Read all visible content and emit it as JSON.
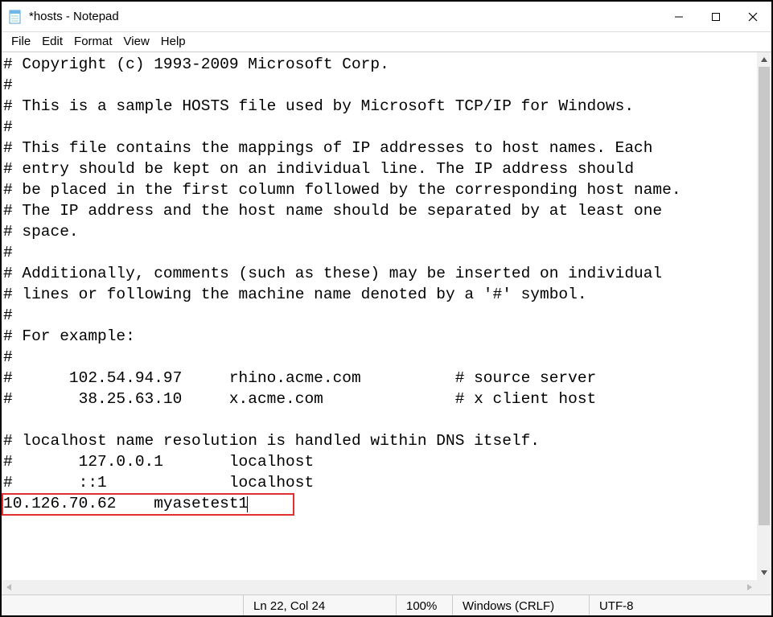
{
  "window": {
    "title": "*hosts - Notepad"
  },
  "menubar": {
    "items": [
      "File",
      "Edit",
      "Format",
      "View",
      "Help"
    ]
  },
  "editor": {
    "lines": [
      "# Copyright (c) 1993-2009 Microsoft Corp.",
      "#",
      "# This is a sample HOSTS file used by Microsoft TCP/IP for Windows.",
      "#",
      "# This file contains the mappings of IP addresses to host names. Each",
      "# entry should be kept on an individual line. The IP address should",
      "# be placed in the first column followed by the corresponding host name.",
      "# The IP address and the host name should be separated by at least one",
      "# space.",
      "#",
      "# Additionally, comments (such as these) may be inserted on individual",
      "# lines or following the machine name denoted by a '#' symbol.",
      "#",
      "# For example:",
      "#",
      "#      102.54.94.97     rhino.acme.com          # source server",
      "#       38.25.63.10     x.acme.com              # x client host",
      "",
      "# localhost name resolution is handled within DNS itself.",
      "#       127.0.0.1       localhost",
      "#       ::1             localhost",
      "10.126.70.62    myasetest1"
    ],
    "highlighted_line_index": 21
  },
  "statusbar": {
    "position": "Ln 22, Col 24",
    "zoom": "100%",
    "line_ending": "Windows (CRLF)",
    "encoding": "UTF-8"
  },
  "icons": {
    "minimize": "—",
    "maximize": "☐",
    "close": "✕"
  }
}
